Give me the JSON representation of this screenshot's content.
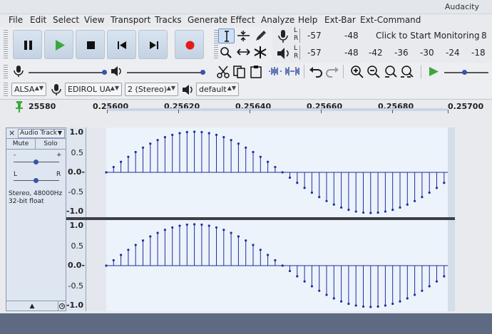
{
  "window": {
    "title": "Audacity"
  },
  "menu": [
    "File",
    "Edit",
    "Select",
    "View",
    "Transport",
    "Tracks",
    "Generate",
    "Effect",
    "Analyze",
    "Help",
    "Ext-Bar",
    "Ext-Command"
  ],
  "meters": {
    "rec_ticks": [
      "-57",
      "-48"
    ],
    "rec_prompt": "Click to Start Monitoring",
    "rec_tail": "8",
    "play_ticks": [
      "-57",
      "-48",
      "-42",
      "-36",
      "-30",
      "-24",
      "-18"
    ],
    "rec_lr": [
      "L",
      "R"
    ],
    "play_lr": [
      "L",
      "R"
    ]
  },
  "device": {
    "host": "ALSA",
    "input": "EDIROL UA-",
    "channels": "2 (Stereo)",
    "output": "default"
  },
  "ruler": {
    "start_label": "25580",
    "labels": [
      "0.25600",
      "0.25620",
      "0.25640",
      "0.25660",
      "0.25680",
      "0.25700"
    ]
  },
  "track": {
    "name": "Audio Track",
    "mute": "Mute",
    "solo": "Solo",
    "gain_minus": "-",
    "gain_plus": "+",
    "pan_left": "L",
    "pan_right": "R",
    "info_rate": "Stereo, 48000Hz",
    "info_format": "32-bit float",
    "close_glyph": "×",
    "collapse_glyph": "▲"
  },
  "amplitude_scale": [
    "1.0",
    "0.5",
    "0.0-",
    "-0.5",
    "-1.0"
  ],
  "colors": {
    "waveform": "#1d2e9e",
    "wave_bg": "#edf3fb",
    "selection_bg": "#d8e3f1",
    "record": "#e51b1b",
    "play": "#3aa83a"
  }
}
